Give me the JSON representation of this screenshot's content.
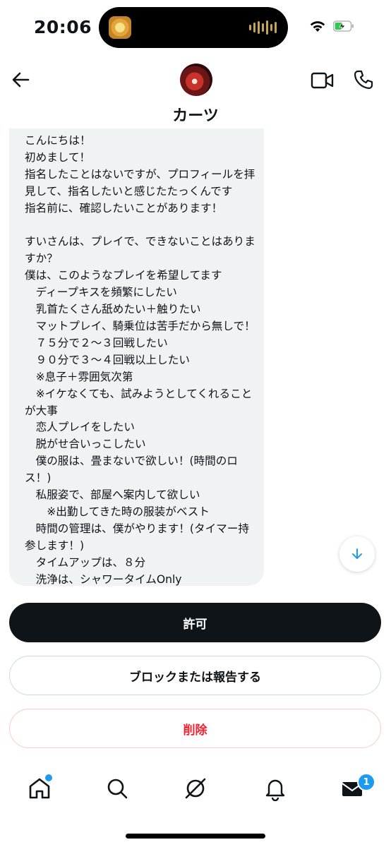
{
  "status_bar": {
    "time": "20:06"
  },
  "header": {
    "name": "カーツ"
  },
  "message": {
    "text": "こんにちは！\n初めまして！\n指名したことはないですが、プロフィールを拝見して、指名したいと感じたたっくんです\n指名前に、確認したいことがあります！\n\nすいさんは、プレイで、できないことはありますか？\n僕は、このようなプレイを希望してます\n　ディープキスを頻繁にしたい\n　乳首たくさん舐めたい＋触りたい\n　マットプレイ、騎乗位は苦手だから無しで！\n　７５分で２〜３回戦したい\n　９０分で３〜４回戦以上したい\n　※息子＋雰囲気次第\n　※イケなくても、試みようとしてくれることが大事\n　恋人プレイをしたい\n　脱がせ合いっこしたい\n　僕の服は、畳まないで欲しい！(時間のロス！)\n　私服姿で、部屋へ案内して欲しい\n　　※出勤してきた時の服装がベスト\n　時間の管理は、僕がやります！(タイマー持参します！)\n　タイムアップは、８分\n　洗浄は、シャワータイムOnly"
  },
  "actions": {
    "accept_label": "許可",
    "block_label": "ブロックまたは報告する",
    "delete_label": "削除"
  },
  "nav": {
    "messages_badge": "1"
  },
  "colors": {
    "accent": "#1d9bf0",
    "danger": "#f4212e",
    "bubble": "#eff3f4",
    "primary_button": "#0f1419"
  }
}
